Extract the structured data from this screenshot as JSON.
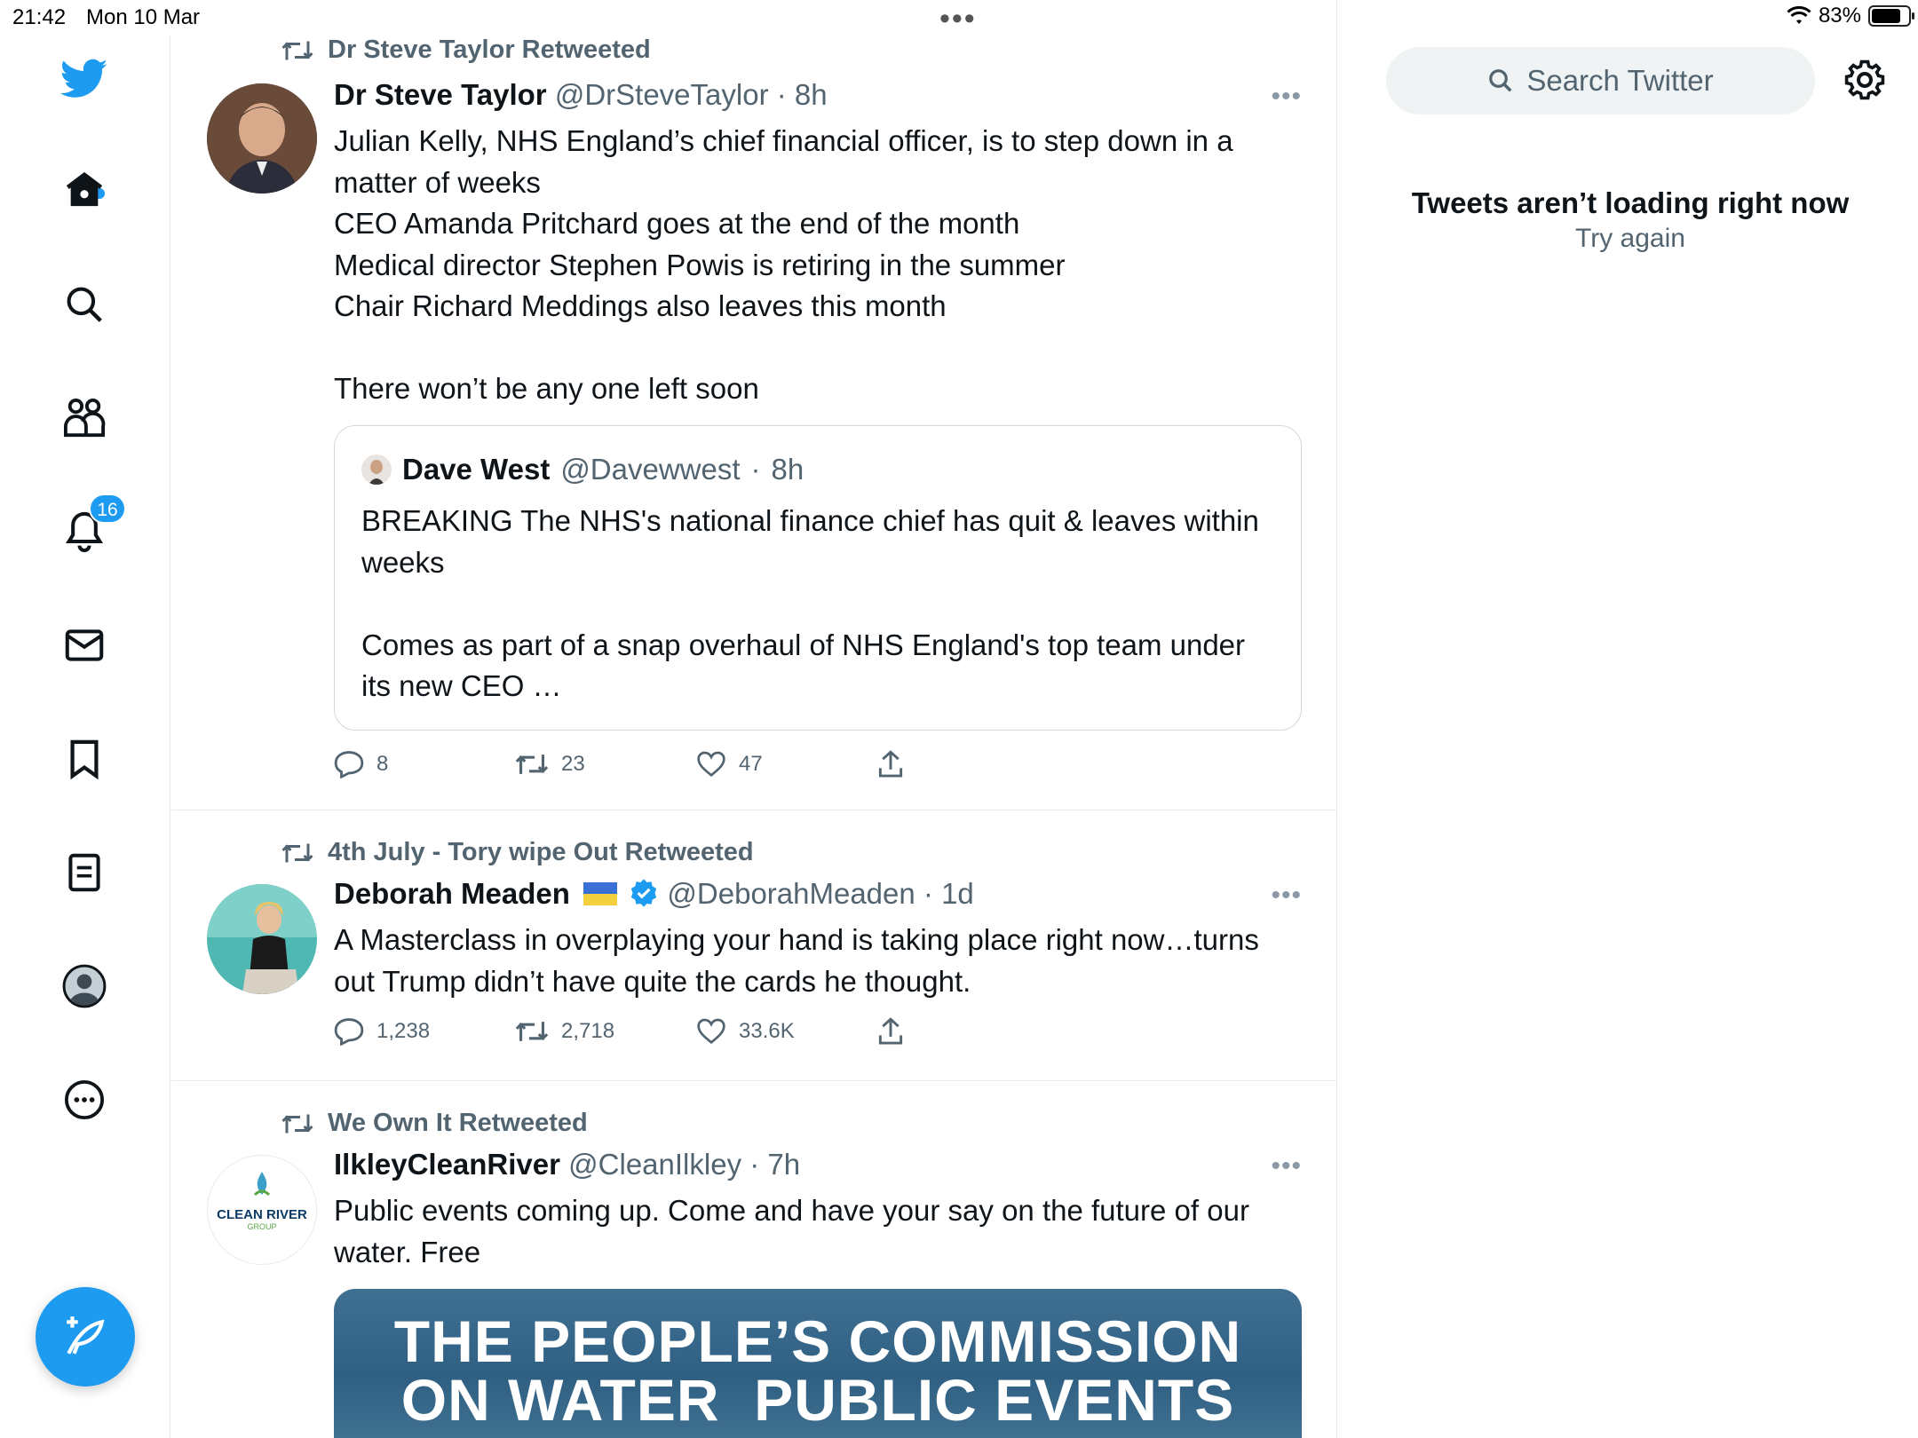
{
  "status_bar": {
    "time": "21:42",
    "date": "Mon 10 Mar",
    "battery": "83%"
  },
  "sidebar": {
    "notifications_badge": "16"
  },
  "tweets": [
    {
      "retweeted_by": "Dr Steve Taylor Retweeted",
      "name": "Dr Steve Taylor",
      "handle": "@DrSteveTaylor",
      "time": "8h",
      "text": "Julian Kelly, NHS England’s chief financial officer, is to step down in a matter of weeks\nCEO Amanda Pritchard goes at the end of the month\nMedical director Stephen Powis is retiring in the summer\nChair Richard Meddings also leaves this month\n\nThere won’t be any one left soon",
      "quote": {
        "name": "Dave West",
        "handle": "@Davewwest",
        "time": "8h",
        "text": "BREAKING The NHS's national finance chief has quit & leaves within weeks\n\nComes as part of a snap overhaul of NHS England's top team under its new CEO …"
      },
      "replies": "8",
      "retweets": "23",
      "likes": "47"
    },
    {
      "retweeted_by": "4th July - Tory wipe Out Retweeted",
      "name": "Deborah Meaden",
      "handle": "@DeborahMeaden",
      "time": "1d",
      "text": "A Masterclass in overplaying your hand is taking place right now…turns out Trump didn’t have quite the cards he thought.",
      "replies": "1,238",
      "retweets": "2,718",
      "likes": "33.6K"
    },
    {
      "retweeted_by": "We Own It Retweeted",
      "name": "IlkleyCleanRiver",
      "handle": "@CleanIlkley",
      "time": "7h",
      "text": "Public events coming up. Come and have your say on the future of our water. Free",
      "avatar_text": "CLEAN RIVER",
      "avatar_subtext": "GROUP",
      "media_text_line1": "THE PEOPLE’S COMMISSION",
      "media_text_line2": "ON WATER  PUBLIC EVENTS"
    }
  ],
  "right": {
    "search_placeholder": "Search Twitter",
    "error_title": "Tweets aren’t loading right now",
    "retry": "Try again"
  },
  "colors": {
    "accent": "#1d9bf0",
    "muted": "#536471",
    "border": "#e6ecf0"
  }
}
